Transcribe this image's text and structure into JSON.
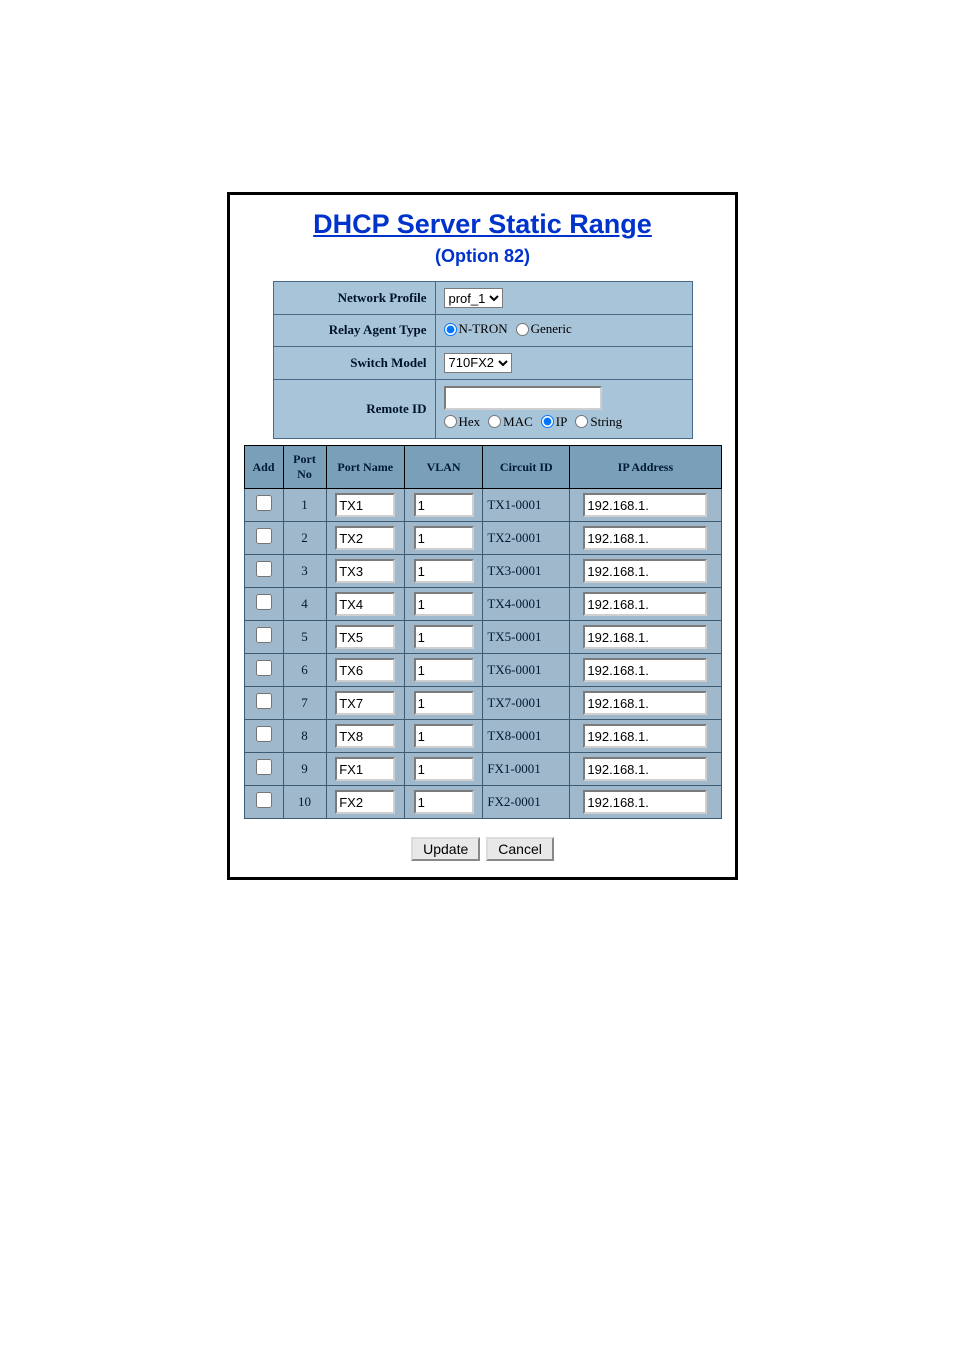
{
  "title": "DHCP Server Static Range",
  "subtitle": "(Option 82)",
  "settings": {
    "network_profile_label": "Network Profile",
    "network_profile_value": "prof_1",
    "relay_agent_type_label": "Relay Agent Type",
    "relay_ntron_label": "N-TRON",
    "relay_generic_label": "Generic",
    "relay_selected": "ntron",
    "switch_model_label": "Switch Model",
    "switch_model_value": "710FX2",
    "remote_id_label": "Remote ID",
    "remote_id_value": "",
    "remote_hex_label": "Hex",
    "remote_mac_label": "MAC",
    "remote_ip_label": "IP",
    "remote_string_label": "String",
    "remote_selected": "ip"
  },
  "columns": {
    "add": "Add",
    "port_no": "Port No",
    "port_name": "Port Name",
    "vlan": "VLAN",
    "circuit_id": "Circuit ID",
    "ip_address": "IP Address"
  },
  "rows": [
    {
      "add": false,
      "port_no": "1",
      "port_name": "TX1",
      "vlan": "1",
      "circuit_id": "TX1-0001",
      "ip": "192.168.1."
    },
    {
      "add": false,
      "port_no": "2",
      "port_name": "TX2",
      "vlan": "1",
      "circuit_id": "TX2-0001",
      "ip": "192.168.1."
    },
    {
      "add": false,
      "port_no": "3",
      "port_name": "TX3",
      "vlan": "1",
      "circuit_id": "TX3-0001",
      "ip": "192.168.1."
    },
    {
      "add": false,
      "port_no": "4",
      "port_name": "TX4",
      "vlan": "1",
      "circuit_id": "TX4-0001",
      "ip": "192.168.1."
    },
    {
      "add": false,
      "port_no": "5",
      "port_name": "TX5",
      "vlan": "1",
      "circuit_id": "TX5-0001",
      "ip": "192.168.1."
    },
    {
      "add": false,
      "port_no": "6",
      "port_name": "TX6",
      "vlan": "1",
      "circuit_id": "TX6-0001",
      "ip": "192.168.1."
    },
    {
      "add": false,
      "port_no": "7",
      "port_name": "TX7",
      "vlan": "1",
      "circuit_id": "TX7-0001",
      "ip": "192.168.1."
    },
    {
      "add": false,
      "port_no": "8",
      "port_name": "TX8",
      "vlan": "1",
      "circuit_id": "TX8-0001",
      "ip": "192.168.1."
    },
    {
      "add": false,
      "port_no": "9",
      "port_name": "FX1",
      "vlan": "1",
      "circuit_id": "FX1-0001",
      "ip": "192.168.1."
    },
    {
      "add": false,
      "port_no": "10",
      "port_name": "FX2",
      "vlan": "1",
      "circuit_id": "FX2-0001",
      "ip": "192.168.1."
    }
  ],
  "buttons": {
    "update": "Update",
    "cancel": "Cancel"
  }
}
